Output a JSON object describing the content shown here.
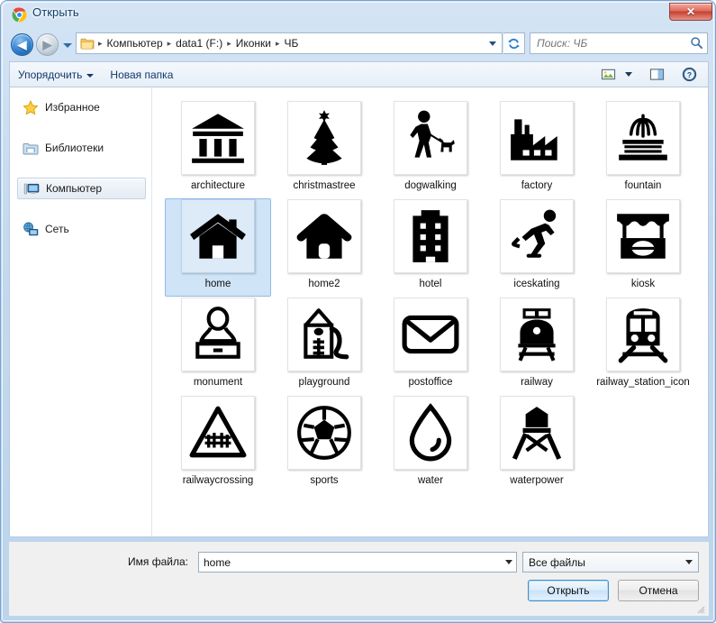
{
  "window": {
    "title": "Открыть",
    "app_icon": "chrome-icon",
    "close_label": "✕"
  },
  "nav": {
    "back_icon": "arrow-left-icon",
    "forward_icon": "arrow-right-icon",
    "history_icon": "chevron-down-icon",
    "refresh_icon": "refresh-icon",
    "folder_icon": "folder-icon",
    "breadcrumb": [
      "Компьютер",
      "data1 (F:)",
      "Иконки",
      "ЧБ"
    ],
    "separator": "▸"
  },
  "search": {
    "placeholder": "Поиск: ЧБ",
    "value": "",
    "icon": "search-icon"
  },
  "command_bar": {
    "organize_label": "Упорядочить",
    "new_folder_label": "Новая папка",
    "view_icon": "view-mode-icon",
    "view_caret_icon": "chevron-down-icon",
    "preview_icon": "preview-pane-icon",
    "help_icon": "help-icon"
  },
  "sidebar": {
    "items": [
      {
        "label": "Избранное",
        "icon": "star-icon",
        "selected": false
      },
      {
        "label": "Библиотеки",
        "icon": "libraries-icon",
        "selected": false
      },
      {
        "label": "Компьютер",
        "icon": "computer-icon",
        "selected": true
      },
      {
        "label": "Сеть",
        "icon": "network-icon",
        "selected": false
      }
    ]
  },
  "files": [
    {
      "name": "architecture",
      "icon": "architecture-icon",
      "selected": false
    },
    {
      "name": "christmastree",
      "icon": "christmastree-icon",
      "selected": false
    },
    {
      "name": "dogwalking",
      "icon": "dogwalking-icon",
      "selected": false
    },
    {
      "name": "factory",
      "icon": "factory-icon",
      "selected": false
    },
    {
      "name": "fountain",
      "icon": "fountain-icon",
      "selected": false
    },
    {
      "name": "home",
      "icon": "home-icon",
      "selected": true
    },
    {
      "name": "home2",
      "icon": "home2-icon",
      "selected": false
    },
    {
      "name": "hotel",
      "icon": "hotel-icon",
      "selected": false
    },
    {
      "name": "iceskating",
      "icon": "iceskating-icon",
      "selected": false
    },
    {
      "name": "kiosk",
      "icon": "kiosk-icon",
      "selected": false
    },
    {
      "name": "monument",
      "icon": "monument-icon",
      "selected": false
    },
    {
      "name": "playground",
      "icon": "playground-icon",
      "selected": false
    },
    {
      "name": "postoffice",
      "icon": "postoffice-icon",
      "selected": false
    },
    {
      "name": "railway",
      "icon": "railway-icon",
      "selected": false
    },
    {
      "name": "railway_station_icon",
      "icon": "railway-station-icon",
      "selected": false
    },
    {
      "name": "railwaycrossing",
      "icon": "railwaycrossing-icon",
      "selected": false
    },
    {
      "name": "sports",
      "icon": "sports-icon",
      "selected": false
    },
    {
      "name": "water",
      "icon": "water-icon",
      "selected": false
    },
    {
      "name": "waterpower",
      "icon": "waterpower-icon",
      "selected": false
    }
  ],
  "footer": {
    "filename_label": "Имя файла:",
    "filename_value": "home",
    "filetype_value": "Все файлы",
    "open_label": "Открыть",
    "cancel_label": "Отмена"
  },
  "colors": {
    "selection_blue": "#cfe4f7",
    "selection_border": "#8fbce8",
    "default_button_border": "#3c8fd0",
    "frame_blue": "#bcd5ec",
    "title_text": "#0b3c68"
  }
}
